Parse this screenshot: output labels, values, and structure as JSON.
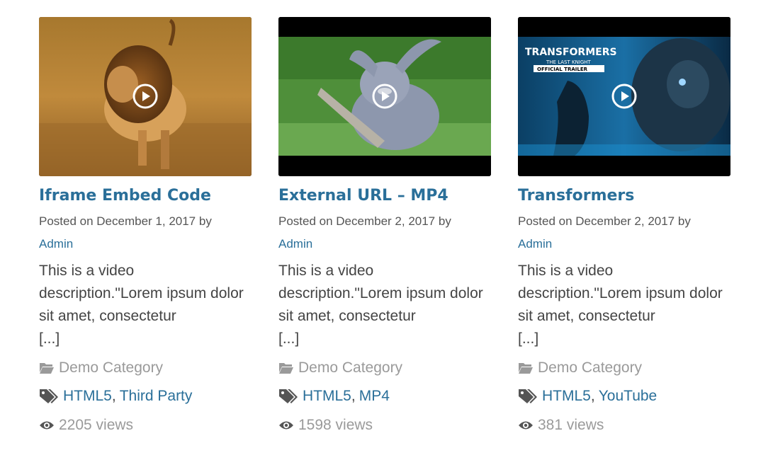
{
  "posts": [
    {
      "title": "Iframe Embed Code",
      "posted_prefix": "Posted on December 1, 2017 by",
      "author": "Admin",
      "description": "This is a video description.\"Lorem ipsum dolor sit amet, consectetur",
      "more": "[...]",
      "category": "Demo Category",
      "tags": [
        "HTML5",
        "Third Party"
      ],
      "views": "2205 views"
    },
    {
      "title": "External URL – MP4",
      "posted_prefix": "Posted on December 2, 2017 by",
      "author": "Admin",
      "description": "This is a video description.\"Lorem ipsum dolor sit amet, consectetur",
      "more": "[...]",
      "category": "Demo Category",
      "tags": [
        "HTML5",
        "MP4"
      ],
      "views": "1598 views"
    },
    {
      "title": "Transformers",
      "posted_prefix": "Posted on December 2, 2017 by",
      "author": "Admin",
      "description": "This is a video description.\"Lorem ipsum dolor sit amet, consectetur",
      "more": "[...]",
      "category": "Demo Category",
      "tags": [
        "HTML5",
        "YouTube"
      ],
      "views": "381 views"
    }
  ],
  "thumbnail_overlay": {
    "line1": "TRANSFORMERS",
    "line2": "THE LAST KNIGHT",
    "line3": "OFFICIAL TRAILER"
  },
  "tag_separator": ",",
  "colors": {
    "link": "#2a6f99",
    "muted": "#9a9a9a",
    "body": "#444444"
  },
  "icons": {
    "play": "play-circle-icon",
    "category": "folder-open-icon",
    "tags": "tags-icon",
    "views": "eye-icon"
  }
}
